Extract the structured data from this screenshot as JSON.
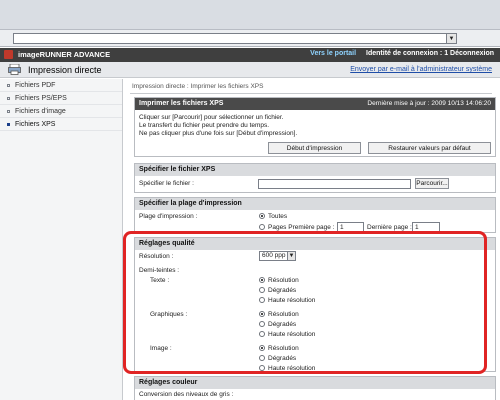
{
  "header": {
    "app_title": "imageRUNNER ADVANCE",
    "portal_link": "Vers le portail",
    "login_text": "Identité de connexion : 1 Déconnexion"
  },
  "title_bar": {
    "title": "Impression directe",
    "email_link": "Envoyer par e-mail à l'administrateur système"
  },
  "sidebar": {
    "items": [
      {
        "label": "Fichiers PDF"
      },
      {
        "label": "Fichiers PS/EPS"
      },
      {
        "label": "Fichiers d'image"
      },
      {
        "label": "Fichiers XPS"
      }
    ]
  },
  "main": {
    "breadcrumb": "Impression directe : Imprimer les fichiers XPS",
    "panel1": {
      "title": "Imprimer les fichiers XPS",
      "updated": "Dernière mise à jour : 2009 10/13 14:06:20",
      "line1": "Cliquer sur [Parcourir] pour sélectionner un fichier.",
      "line2": "Le transfert du fichier peut prendre du temps.",
      "line3": "Ne pas cliquer plus d'une fois sur [Début d'impression].",
      "start_button": "Début d'impression",
      "reset_button": "Restaurer valeurs par défaut"
    },
    "panel2": {
      "title": "Spécifier le fichier XPS",
      "label": "Spécifier le fichier :",
      "browse_button": "Parcourir..."
    },
    "panel3": {
      "title": "Spécifier la plage d'impression",
      "label": "Plage d'impression :",
      "opt_all": "Toutes",
      "opt_pages": "Pages Première page :",
      "first_value": "1",
      "last_label": "Dernière page :",
      "last_value": "1"
    },
    "panel4": {
      "title": "Réglages qualité",
      "resolution_label": "Résolution :",
      "resolution_value": "600 ppp",
      "halftone_label": "Demi-teintes :",
      "groups": [
        {
          "label": "Texte :",
          "options": [
            "Résolution",
            "Dégradés",
            "Haute résolution"
          ]
        },
        {
          "label": "Graphiques :",
          "options": [
            "Résolution",
            "Dégradés",
            "Haute résolution"
          ]
        },
        {
          "label": "Image :",
          "options": [
            "Résolution",
            "Dégradés",
            "Haute résolution"
          ]
        }
      ]
    },
    "panel5": {
      "title": "Réglages couleur",
      "label": "Conversion des niveaux de gris :"
    }
  },
  "colors": {
    "accent_red": "#e02424",
    "header_dark": "#3f3f3f",
    "portal_link": "#8fd3ff",
    "link_blue": "#1f4ea8"
  }
}
